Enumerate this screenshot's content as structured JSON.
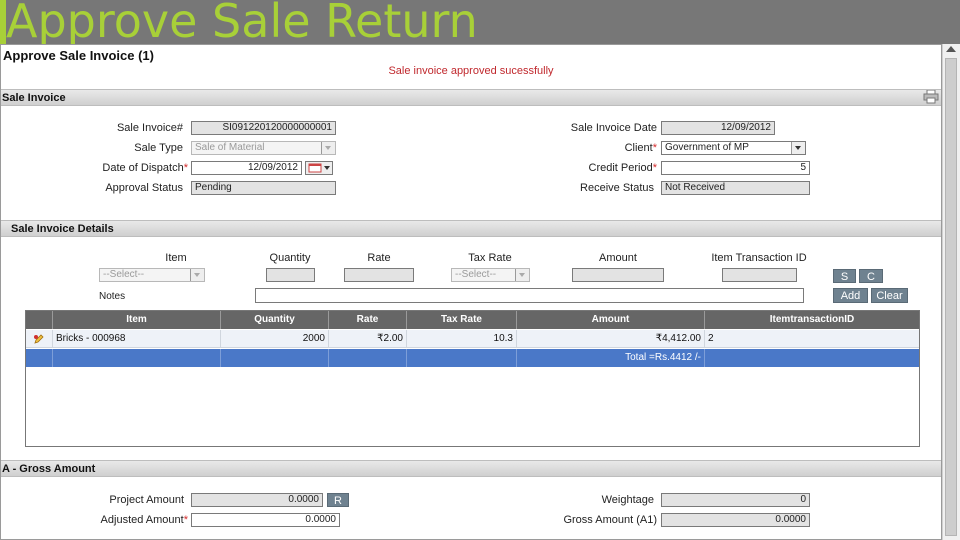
{
  "banner": {
    "title": "Approve Sale Return"
  },
  "page": {
    "title": "Approve Sale Invoice (1)",
    "success_message": "Sale invoice approved sucessfully"
  },
  "sale_invoice": {
    "section_title": "Sale Invoice",
    "sale_invoice_no_label": "Sale Invoice#",
    "sale_invoice_no": "SI091220120000000001",
    "sale_type_label": "Sale Type",
    "sale_type": "Sale of Material",
    "date_of_dispatch_label": "Date of Dispatch",
    "date_of_dispatch": "12/09/2012",
    "approval_status_label": "Approval Status",
    "approval_status": "Pending",
    "sale_invoice_date_label": "Sale Invoice Date",
    "sale_invoice_date": "12/09/2012",
    "client_label": "Client",
    "client": "Government of MP",
    "credit_period_label": "Credit Period",
    "credit_period": "5",
    "receive_status_label": "Receive Status",
    "receive_status": "Not Received",
    "required_mark": "*"
  },
  "details": {
    "section_title": "Sale Invoice Details",
    "item_label": "Item",
    "item_placeholder": "--Select--",
    "quantity_label": "Quantity",
    "rate_label": "Rate",
    "tax_rate_label": "Tax Rate",
    "tax_rate_placeholder": "--Select--",
    "amount_label": "Amount",
    "item_transaction_id_label": "Item Transaction ID",
    "notes_label": "Notes",
    "btn_s": "S",
    "btn_c": "C",
    "btn_add": "Add",
    "btn_clear": "Clear"
  },
  "grid": {
    "headers": [
      "Item",
      "Quantity",
      "Rate",
      "Tax Rate",
      "Amount",
      "ItemtransactionID"
    ],
    "rows": [
      {
        "item": "Bricks - 000968",
        "quantity": "2000",
        "rate": "₹2.00",
        "tax_rate": "10.3",
        "amount": "₹4,412.00",
        "item_transaction_id": "2"
      }
    ],
    "total": "Total =Rs.4412 /-"
  },
  "gross": {
    "section_title": "A - Gross Amount",
    "project_amount_label": "Project Amount",
    "project_amount": "0.0000",
    "btn_r": "R",
    "adjusted_amount_label": "Adjusted Amount",
    "adjusted_amount": "0.0000",
    "weightage_label": "Weightage",
    "weightage": "0",
    "gross_amount_label": "Gross Amount (A1)",
    "gross_amount": "0.0000"
  },
  "colors": {
    "banner_bg": "#777777",
    "banner_text": "#a8d038",
    "success": "#c0282d",
    "grid_header": "#666666",
    "grid_total": "#4a78c8",
    "button": "#6f8290"
  }
}
